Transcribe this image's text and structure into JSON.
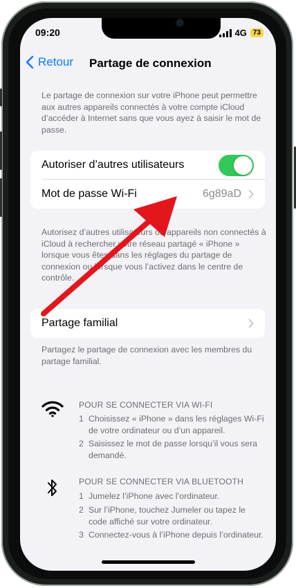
{
  "status_bar": {
    "time": "09:20",
    "network": "4G",
    "battery": "73"
  },
  "nav": {
    "back_label": "Retour",
    "title": "Partage de connexion"
  },
  "intro_text": "Le partage de connexion sur votre iPhone peut permettre aux autres appareils connectés à votre compte iCloud d’accéder à Internet sans que vous ayez à saisir le mot de passe.",
  "settings": {
    "allow_others_label": "Autoriser d’autres utilisateurs",
    "allow_others_on": true,
    "wifi_password_label": "Mot de passe Wi-Fi",
    "wifi_password_value": "6g89aD"
  },
  "allow_others_note": "Autorisez d’autres utilisateurs ou appareils non connectés à iCloud à rechercher votre réseau partagé « iPhone » lorsque vous êtes dans les réglages du partage de connexion ou lorsque vous l’activez dans le centre de contrôle.",
  "family": {
    "label": "Partage familial",
    "note": "Partagez le partage de connexion avec les membres du partage familial."
  },
  "wifi_instructions": {
    "icon": "wifi-icon",
    "heading": "POUR SE CONNECTER VIA WI-FI",
    "steps": [
      {
        "n": "1",
        "text": "Choisissez « iPhone » dans les réglages Wi-Fi de votre ordinateur ou d’un appareil."
      },
      {
        "n": "2",
        "text": "Saisissez le mot de passe lorsqu’il vous sera demandé."
      }
    ]
  },
  "bluetooth_instructions": {
    "icon": "bluetooth-icon",
    "heading": "POUR SE CONNECTER VIA BLUETOOTH",
    "steps": [
      {
        "n": "1",
        "text": "Jumelez l’iPhone avec l’ordinateur."
      },
      {
        "n": "2",
        "text": "Sur l’iPhone, touchez Jumeler ou tapez le code affiché sur votre ordinateur."
      },
      {
        "n": "3",
        "text": "Connectez-vous à l’iPhone depuis l’ordinateur."
      }
    ]
  },
  "colors": {
    "accent": "#0a7aff",
    "toggle_on": "#34c759",
    "annotation_arrow": "#e3161b",
    "battery": "#f7d54a"
  }
}
